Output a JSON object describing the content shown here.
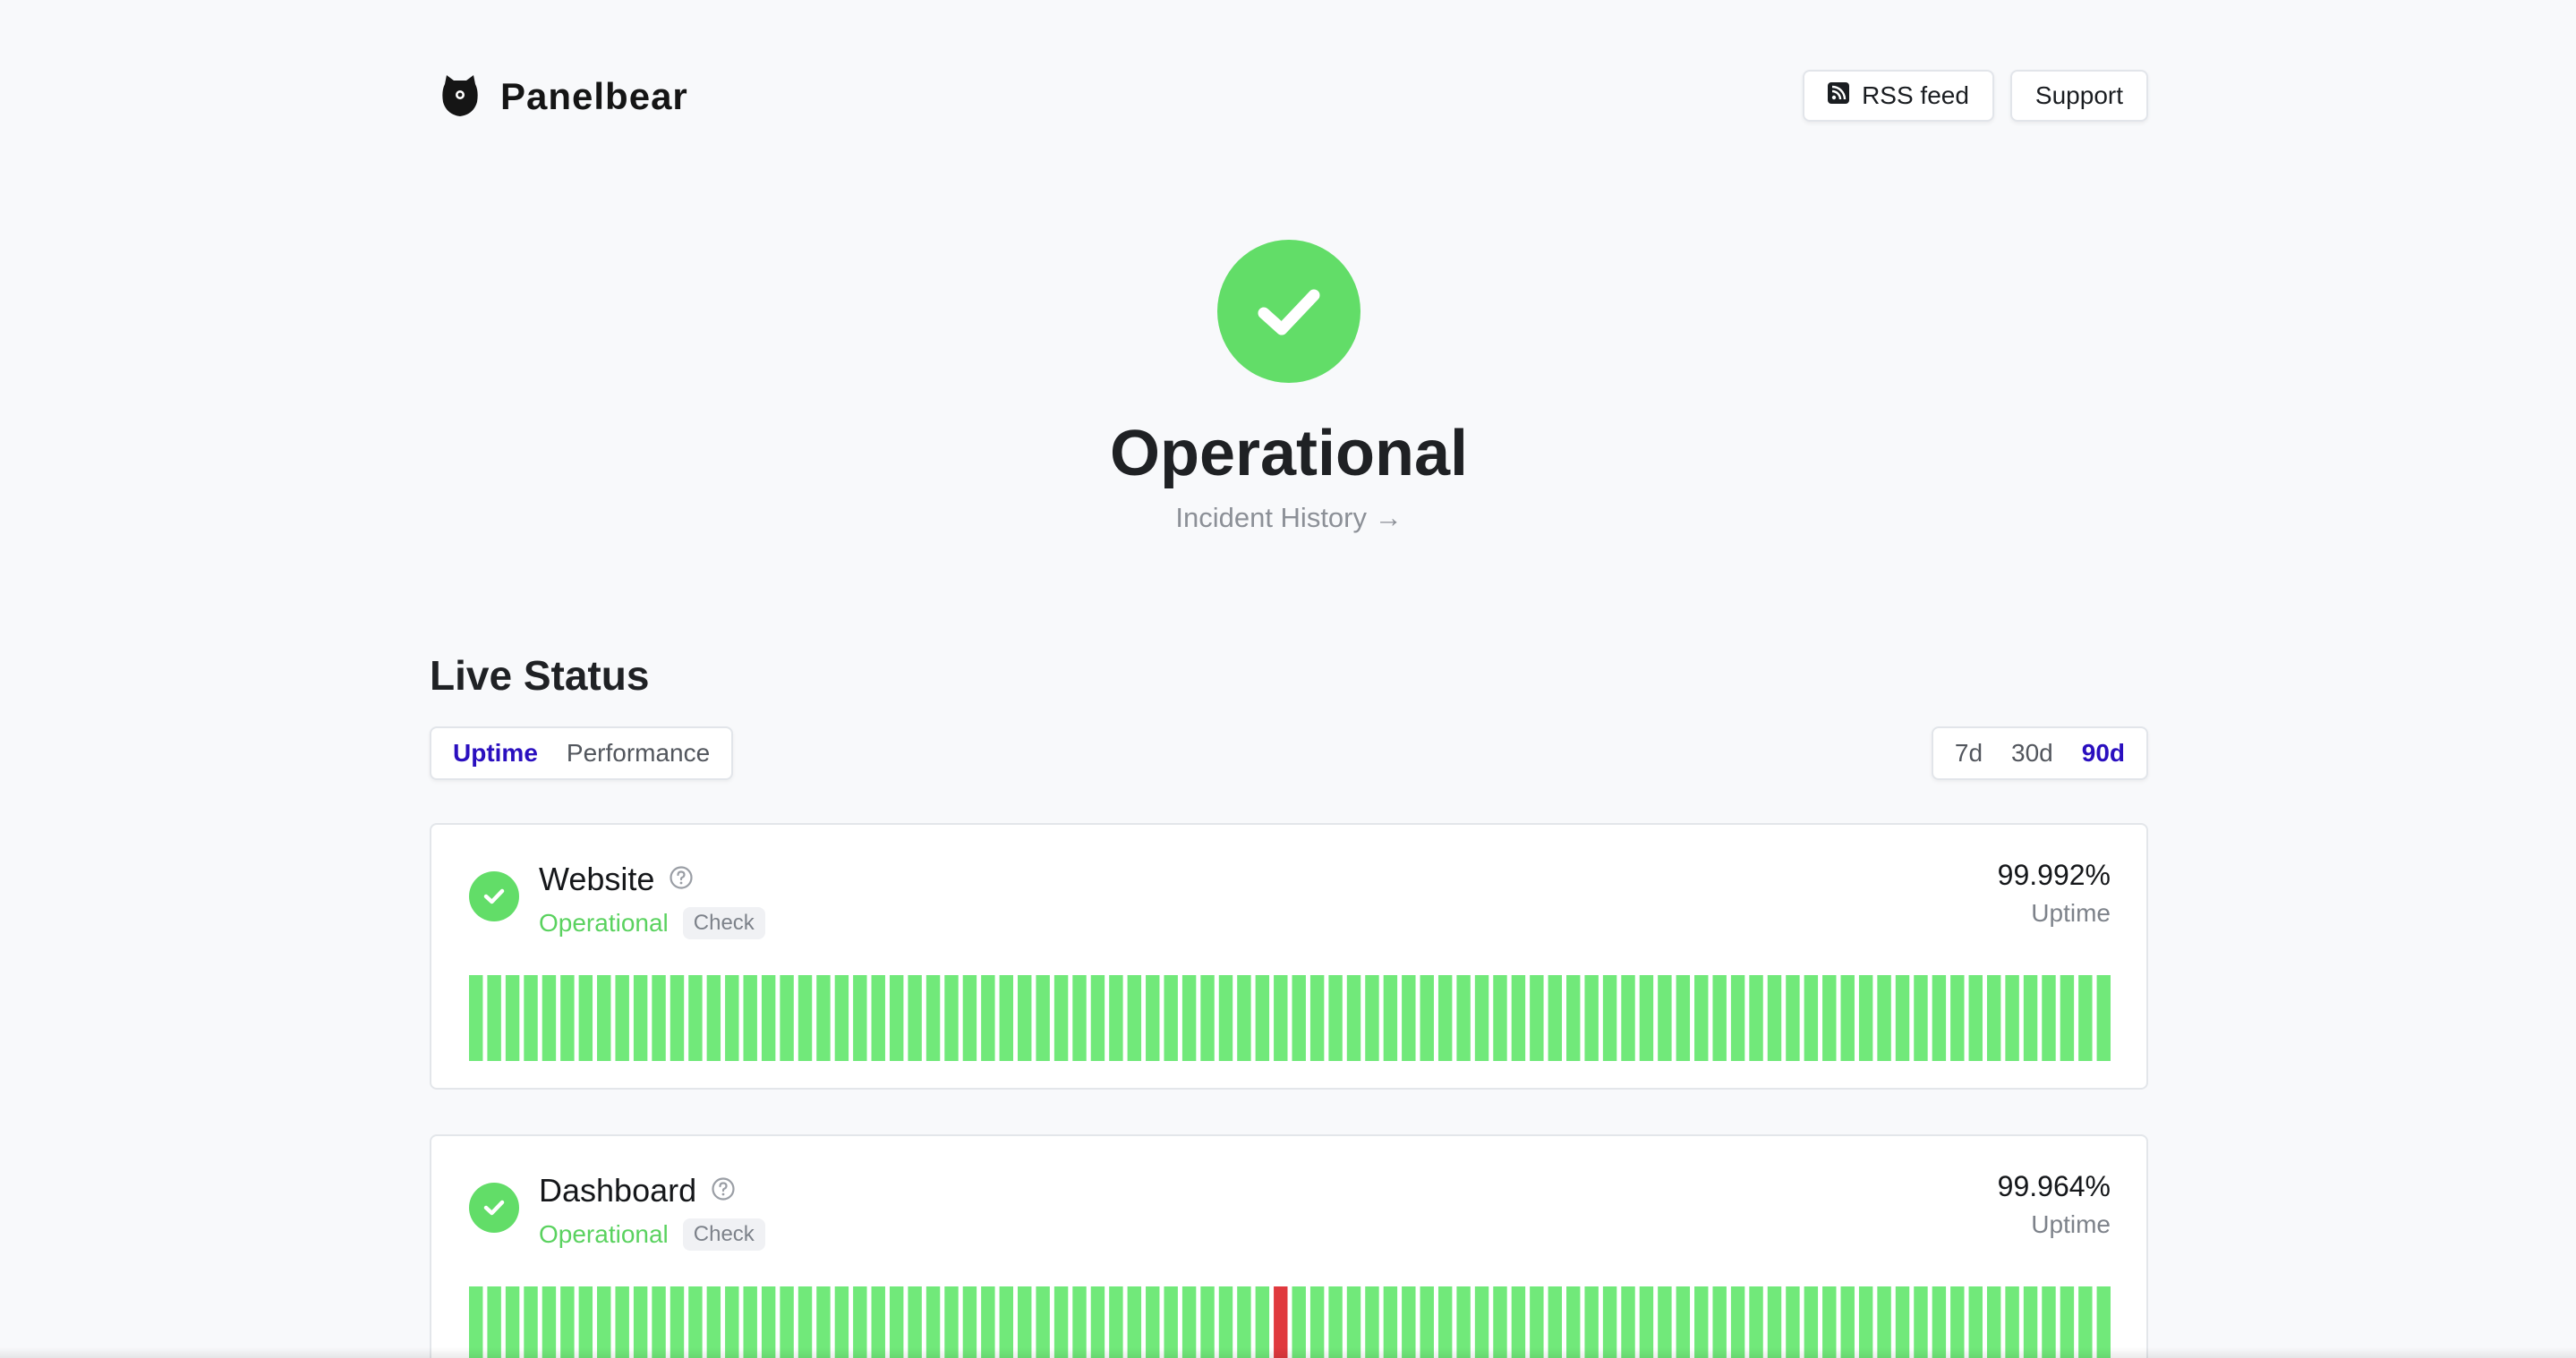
{
  "header": {
    "brand": "Panelbear",
    "rss_label": "RSS feed",
    "support_label": "Support"
  },
  "hero": {
    "status": "Operational",
    "incident_link": "Incident History →"
  },
  "live_status": {
    "title": "Live Status",
    "metric_tabs": [
      {
        "label": "Uptime",
        "active": true
      },
      {
        "label": "Performance",
        "active": false
      }
    ],
    "range_tabs": [
      {
        "label": "7d",
        "active": false
      },
      {
        "label": "30d",
        "active": false
      },
      {
        "label": "90d",
        "active": true
      }
    ]
  },
  "colors": {
    "operational": "#62dd68",
    "bar_ok": "#71e97a",
    "bar_down": "#e0393e",
    "accent": "#2a0fbf"
  },
  "services": [
    {
      "name": "Website",
      "status": "Operational",
      "badge": "Check",
      "uptime": "99.992%",
      "uptime_label": "Uptime",
      "days": 90,
      "down_days": []
    },
    {
      "name": "Dashboard",
      "status": "Operational",
      "badge": "Check",
      "uptime": "99.964%",
      "uptime_label": "Uptime",
      "days": 90,
      "down_days": [
        44
      ]
    }
  ]
}
